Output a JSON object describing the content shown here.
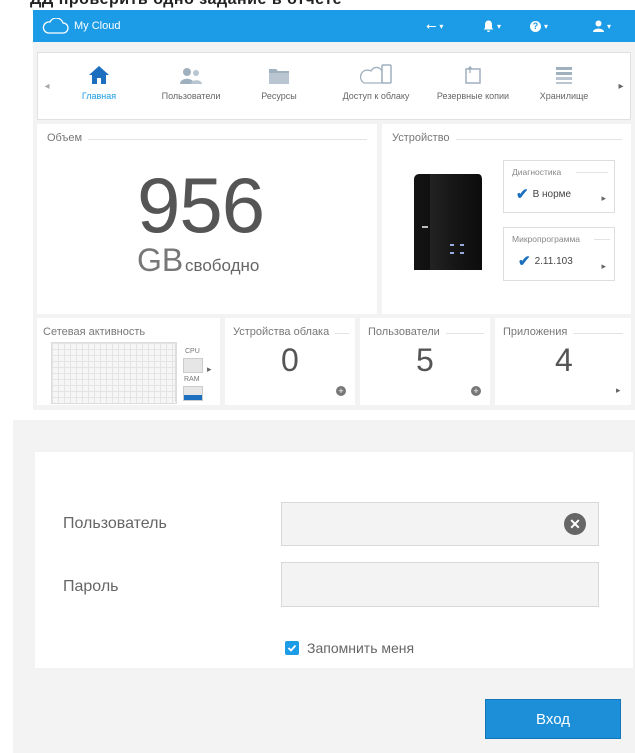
{
  "header_fragment": "ДД проверить одно задание в отчете",
  "app": {
    "title": "My Cloud"
  },
  "nav": {
    "items": [
      {
        "label": "Главная",
        "icon": "home-icon"
      },
      {
        "label": "Пользователи",
        "icon": "users-icon"
      },
      {
        "label": "Ресурсы",
        "icon": "folder-icon"
      },
      {
        "label": "Доступ к облаку",
        "icon": "cloud-access-icon"
      },
      {
        "label": "Резервные копии",
        "icon": "backup-icon"
      },
      {
        "label": "Хранилище",
        "icon": "storage-icon"
      }
    ]
  },
  "volume": {
    "title": "Объем",
    "value": "956",
    "unit": "GB",
    "free_label": "свободно"
  },
  "device": {
    "title": "Устройство",
    "diagnostics": {
      "title": "Диагностика",
      "status": "В норме"
    },
    "firmware": {
      "title": "Микропрограмма",
      "version": "2.11.103"
    }
  },
  "network": {
    "title": "Сетевая активность",
    "cpu_label": "CPU",
    "ram_label": "RAM"
  },
  "cloud_devices": {
    "title": "Устройства облака",
    "count": "0"
  },
  "users": {
    "title": "Пользователи",
    "count": "5"
  },
  "apps": {
    "title": "Приложения",
    "count": "4"
  },
  "login": {
    "username_label": "Пользователь",
    "username_value": "",
    "password_label": "Пароль",
    "password_value": "",
    "remember_label": "Запомнить меня",
    "remember_checked": true,
    "submit_label": "Вход"
  },
  "colors": {
    "accent": "#1c9be6",
    "button": "#1c8fd8"
  }
}
